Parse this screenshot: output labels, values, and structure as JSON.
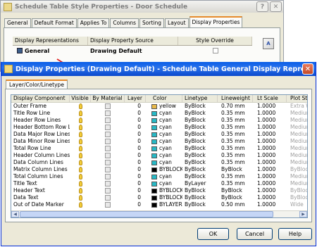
{
  "back_window": {
    "title": "Schedule Table Style Properties - Door Schedule",
    "help_label": "?",
    "close_label": "✕",
    "tabs": [
      "General",
      "Default Format",
      "Applies To",
      "Columns",
      "Sorting",
      "Layout",
      "Display Properties"
    ],
    "active_tab": "Display Properties",
    "table": {
      "headers": [
        "Display Representations",
        "Display Property Source",
        "Style Override"
      ],
      "row": {
        "rep": "General",
        "source": "Drawing Default",
        "override": false
      }
    }
  },
  "dialog": {
    "title": "Display Properties (Drawing Default) - Schedule Table General Display Representation",
    "close_label": "✕",
    "tab": "Layer/Color/Linetype",
    "columns": [
      "Display Component",
      "Visible",
      "By Material",
      "Layer",
      "Color",
      "Linetype",
      "Lineweight",
      "Lt Scale",
      "Plot St"
    ],
    "rows": [
      {
        "component": "Outer Frame",
        "layer": "0",
        "color": "yellow",
        "swatch": "#e8b94a",
        "linetype": "ByBlock",
        "lineweight": "0.70 mm",
        "ltscale": "1.0000",
        "plot": "Extra W"
      },
      {
        "component": "Title Row Line",
        "layer": "0",
        "color": "cyan",
        "swatch": "#27b9c6",
        "linetype": "ByBlock",
        "lineweight": "0.35 mm",
        "ltscale": "1.0000",
        "plot": "Medium"
      },
      {
        "component": "Header Row Lines",
        "layer": "0",
        "color": "cyan",
        "swatch": "#27b9c6",
        "linetype": "ByBlock",
        "lineweight": "0.35 mm",
        "ltscale": "1.0000",
        "plot": "Medium"
      },
      {
        "component": "Header Bottom Row Li",
        "layer": "0",
        "color": "cyan",
        "swatch": "#27b9c6",
        "linetype": "ByBlock",
        "lineweight": "0.35 mm",
        "ltscale": "1.0000",
        "plot": "Medium"
      },
      {
        "component": "Data Major Row Lines",
        "layer": "0",
        "color": "cyan",
        "swatch": "#27b9c6",
        "linetype": "ByBlock",
        "lineweight": "0.35 mm",
        "ltscale": "1.0000",
        "plot": "Medium"
      },
      {
        "component": "Data Minor Row Lines",
        "layer": "0",
        "color": "cyan",
        "swatch": "#27b9c6",
        "linetype": "ByBlock",
        "lineweight": "0.35 mm",
        "ltscale": "1.0000",
        "plot": "Medium"
      },
      {
        "component": "Total Row Line",
        "layer": "0",
        "color": "cyan",
        "swatch": "#27b9c6",
        "linetype": "ByBlock",
        "lineweight": "0.35 mm",
        "ltscale": "1.0000",
        "plot": "Medium"
      },
      {
        "component": "Header Column Lines",
        "layer": "0",
        "color": "cyan",
        "swatch": "#27b9c6",
        "linetype": "ByBlock",
        "lineweight": "0.35 mm",
        "ltscale": "1.0000",
        "plot": "Medium"
      },
      {
        "component": "Data Column Lines",
        "layer": "0",
        "color": "cyan",
        "swatch": "#27b9c6",
        "linetype": "ByBlock",
        "lineweight": "0.35 mm",
        "ltscale": "1.0000",
        "plot": "Medium"
      },
      {
        "component": "Matrix Column Lines",
        "layer": "0",
        "color": "BYBLOCK",
        "swatch": "#000000",
        "linetype": "ByBlock",
        "lineweight": "ByBlock",
        "ltscale": "1.0000",
        "plot": "ByBlock"
      },
      {
        "component": "Total Column Lines",
        "layer": "0",
        "color": "cyan",
        "swatch": "#27b9c6",
        "linetype": "ByBlock",
        "lineweight": "0.35 mm",
        "ltscale": "1.0000",
        "plot": "Medium"
      },
      {
        "component": "Title Text",
        "layer": "0",
        "color": "cyan",
        "swatch": "#27b9c6",
        "linetype": "ByLayer",
        "lineweight": "0.35 mm",
        "ltscale": "1.0000",
        "plot": "Medium"
      },
      {
        "component": "Header Text",
        "layer": "0",
        "color": "BYBLOCK",
        "swatch": "#000000",
        "linetype": "ByBlock",
        "lineweight": "ByBlock",
        "ltscale": "1.0000",
        "plot": "ByBlock"
      },
      {
        "component": "Data Text",
        "layer": "0",
        "color": "BYBLOCK",
        "swatch": "#000000",
        "linetype": "ByBlock",
        "lineweight": "ByBlock",
        "ltscale": "1.0000",
        "plot": "ByBlock"
      },
      {
        "component": "Out of Date Marker",
        "layer": "0",
        "color": "BYLAYER",
        "swatch": "#000000",
        "linetype": "ByBlock",
        "lineweight": "0.50 mm",
        "ltscale": "1.0000",
        "plot": "Wide"
      }
    ],
    "buttons": {
      "ok": "OK",
      "cancel": "Cancel",
      "help": "Help"
    }
  },
  "colors": {
    "title_bar": "#0a5ee8",
    "tab_accent": "#e68b2c",
    "arrow": "#e02020"
  }
}
